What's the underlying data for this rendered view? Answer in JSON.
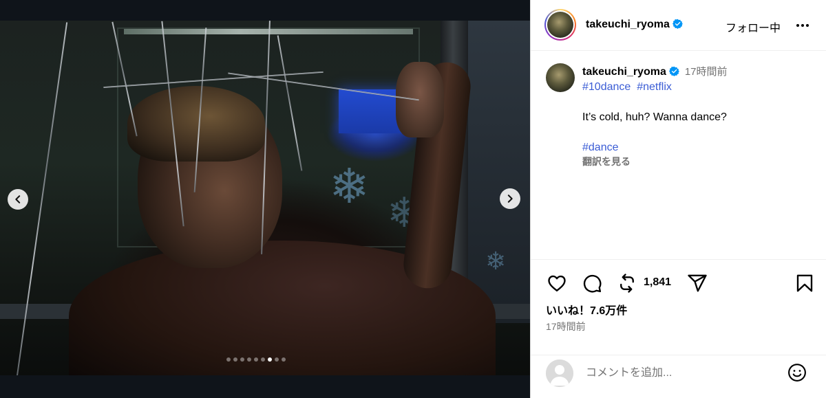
{
  "media": {
    "carousel": {
      "total_slides": 9,
      "active_slide_index": 6
    },
    "icons": {
      "prev": "chevron-left-icon",
      "next": "chevron-right-icon"
    }
  },
  "header": {
    "username": "takeuchi_ryoma",
    "follow_state": "フォロー中",
    "icons": {
      "verified": "verified-badge-icon",
      "more": "more-options-icon"
    }
  },
  "caption": {
    "username": "takeuchi_ryoma",
    "time": "17時間前",
    "hashtags_line1": [
      "#10dance",
      "#netflix"
    ],
    "text": "It’s cold, huh? Wanna dance?",
    "hashtag_line2": "#dance",
    "translate_label": "翻訳を見る"
  },
  "actions": {
    "repost_count": "1,841",
    "likes_label": "いいね！7.6万件",
    "post_time": "17時間前",
    "icons": {
      "like": "heart-icon",
      "comment": "comment-icon",
      "repost": "repost-icon",
      "share": "share-icon",
      "save": "bookmark-icon"
    }
  },
  "comment": {
    "placeholder": "コメントを追加...",
    "icons": {
      "avatar": "default-avatar-icon",
      "emoji": "emoji-icon"
    }
  },
  "colors": {
    "link": "#3a5cd5",
    "verified": "#0095f6",
    "secondary_text": "#737373",
    "media_background": "#0f141a"
  }
}
